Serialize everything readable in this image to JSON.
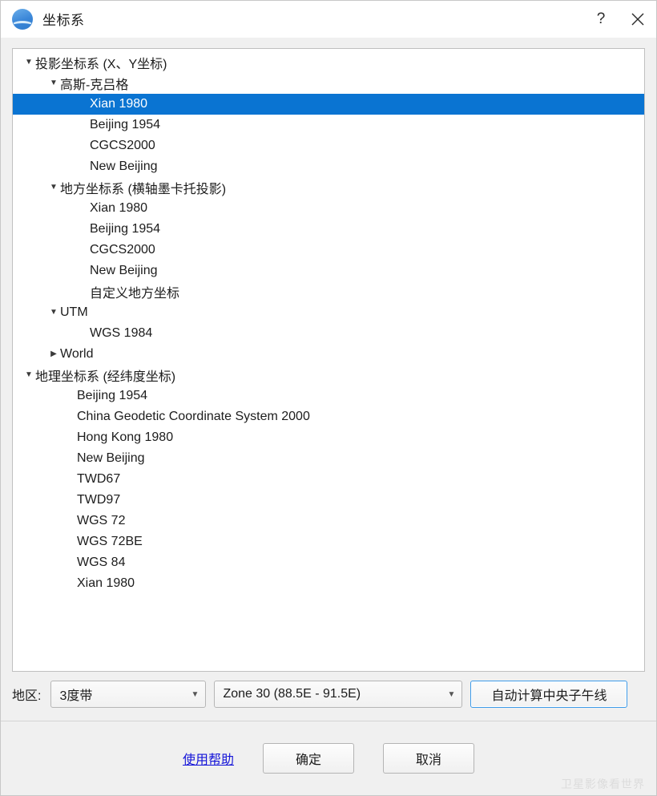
{
  "window": {
    "title": "坐标系",
    "icon": "globe-icon",
    "help_button": "?",
    "close_button": "close-icon"
  },
  "tree": {
    "selected": "Xian 1980",
    "nodes": [
      {
        "label": "投影坐标系 (X、Y坐标)",
        "level": 0,
        "arrow": "expanded",
        "selected": false
      },
      {
        "label": "高斯-克吕格",
        "level": 1,
        "arrow": "expanded",
        "selected": false
      },
      {
        "label": "Xian 1980",
        "level": 2,
        "arrow": "none",
        "selected": true
      },
      {
        "label": "Beijing 1954",
        "level": 2,
        "arrow": "none",
        "selected": false
      },
      {
        "label": "CGCS2000",
        "level": 2,
        "arrow": "none",
        "selected": false
      },
      {
        "label": "New Beijing",
        "level": 2,
        "arrow": "none",
        "selected": false
      },
      {
        "label": "地方坐标系 (横轴墨卡托投影)",
        "level": 1,
        "arrow": "expanded",
        "selected": false
      },
      {
        "label": "Xian 1980",
        "level": 2,
        "arrow": "none",
        "selected": false
      },
      {
        "label": "Beijing 1954",
        "level": 2,
        "arrow": "none",
        "selected": false
      },
      {
        "label": "CGCS2000",
        "level": 2,
        "arrow": "none",
        "selected": false
      },
      {
        "label": "New Beijing",
        "level": 2,
        "arrow": "none",
        "selected": false
      },
      {
        "label": "自定义地方坐标",
        "level": 2,
        "arrow": "none",
        "selected": false
      },
      {
        "label": "UTM",
        "level": 1,
        "arrow": "expanded",
        "selected": false
      },
      {
        "label": "WGS 1984",
        "level": 2,
        "arrow": "none",
        "selected": false
      },
      {
        "label": "World",
        "level": 1,
        "arrow": "collapsed",
        "selected": false
      },
      {
        "label": "地理坐标系 (经纬度坐标)",
        "level": 0,
        "arrow": "expanded",
        "selected": false
      },
      {
        "label": "Beijing 1954",
        "level": 1,
        "arrow": "none",
        "selected": false
      },
      {
        "label": "China Geodetic Coordinate System 2000",
        "level": 1,
        "arrow": "none",
        "selected": false
      },
      {
        "label": "Hong Kong 1980",
        "level": 1,
        "arrow": "none",
        "selected": false
      },
      {
        "label": "New Beijing",
        "level": 1,
        "arrow": "none",
        "selected": false
      },
      {
        "label": "TWD67",
        "level": 1,
        "arrow": "none",
        "selected": false
      },
      {
        "label": "TWD97",
        "level": 1,
        "arrow": "none",
        "selected": false
      },
      {
        "label": "WGS 72",
        "level": 1,
        "arrow": "none",
        "selected": false
      },
      {
        "label": "WGS 72BE",
        "level": 1,
        "arrow": "none",
        "selected": false
      },
      {
        "label": "WGS 84",
        "level": 1,
        "arrow": "none",
        "selected": false
      },
      {
        "label": "Xian 1980",
        "level": 1,
        "arrow": "none",
        "selected": false
      }
    ]
  },
  "zone_bar": {
    "label": "地区:",
    "degree_combo": {
      "value": "3度带",
      "arrow": "chevron-down-icon"
    },
    "zone_combo": {
      "value": "Zone 30 (88.5E - 91.5E)",
      "arrow": "chevron-down-icon"
    },
    "auto_calc_button": "自动计算中央子午线"
  },
  "footer": {
    "help_link": "使用帮助",
    "ok_button": "确定",
    "cancel_button": "取消",
    "watermark": "卫星影像看世界"
  },
  "colors": {
    "selection": "#0a74d2",
    "focus_border": "#3d9ae8",
    "link": "#1414d8",
    "dialog_bg": "#f0f0f0",
    "panel_bg": "#ffffff",
    "watermark": "#dcdcdc"
  }
}
